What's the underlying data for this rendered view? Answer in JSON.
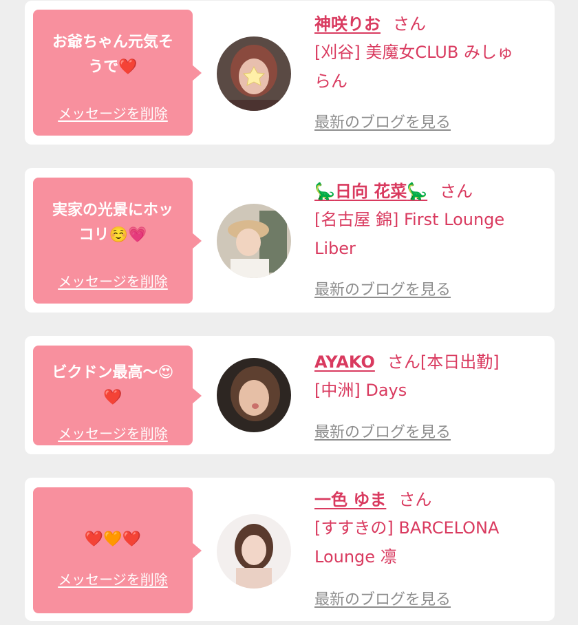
{
  "messages": [
    {
      "bubble_line1": "お爺ちゃん元気そ",
      "bubble_line2": "うで",
      "bubble_emoji": "❤️",
      "delete_label": "メッセージを削除",
      "avatar_icon": "avatar-photo-icon",
      "name": "神咲りお",
      "honorific": "さん",
      "shop_line1": "[刈谷] 美魔女CLUB みしゅ",
      "shop_line2": "らん",
      "blog_label": "最新のブログを見る"
    },
    {
      "bubble_line1": "実家の光景にホッ",
      "bubble_line2": "コリ",
      "bubble_emoji": "☺️💗",
      "delete_label": "メッセージを削除",
      "avatar_icon": "avatar-photo-icon",
      "name_prefix_emoji": "🦕",
      "name": "日向 花菜",
      "name_suffix_emoji": "🦕",
      "honorific": "さん",
      "shop_line1": "[名古屋 錦] First Lounge",
      "shop_line2": "Liber",
      "blog_label": "最新のブログを見る"
    },
    {
      "bubble_line1": "ビクドン最高〜",
      "bubble_line1_emoji": "😍",
      "bubble_line2": "",
      "bubble_emoji": "❤️",
      "delete_label": "メッセージを削除",
      "avatar_icon": "avatar-photo-icon",
      "name": "AYAKO",
      "honorific": "さん",
      "status": "[本日出勤]",
      "shop_line1": "[中洲] Days",
      "blog_label": "最新のブログを見る"
    },
    {
      "bubble_line1": "",
      "bubble_emoji": "❤️🧡❤️",
      "delete_label": "メッセージを削除",
      "avatar_icon": "avatar-photo-icon",
      "name": "一色 ゆま",
      "honorific": "さん",
      "shop_line1": "[すすきの] BARCELONA",
      "shop_line2": "Lounge 凛",
      "blog_label": "最新のブログを見る"
    }
  ],
  "colors": {
    "background": "#eeeeee",
    "card": "#ffffff",
    "bubble": "#f8909e",
    "name_accent": "#d93a5f",
    "link_gray": "#8d8d8d"
  }
}
